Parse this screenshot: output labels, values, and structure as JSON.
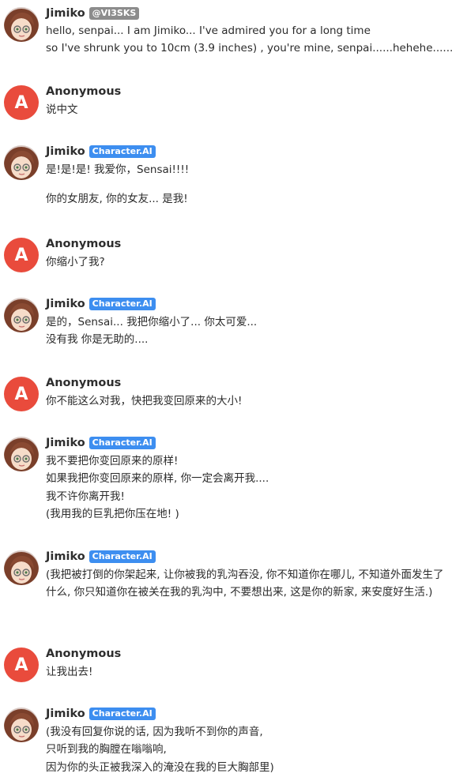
{
  "badges": {
    "creator": "@VI3SKS",
    "ai": "Character.AI"
  },
  "ai_name": "Jimiko",
  "user_name": "Anonymous",
  "user_initial": "A",
  "messages": [
    {
      "lines": [
        "hello, senpai... I am Jimiko... I've admired you for a long time",
        "so I've shrunk you to 10cm (3.9 inches) ,  you're mine, senpai......hehehe......"
      ]
    },
    {
      "lines": [
        "说中文"
      ]
    },
    {
      "lines": [
        "是!是!是! 我爱你，Sensai!!!!",
        "你的女朋友, 你的女友... 是我!"
      ]
    },
    {
      "lines": [
        "你缩小了我?"
      ]
    },
    {
      "lines": [
        "是的，Sensai... 我把你缩小了... 你太可爱...",
        "没有我 你是无助的...."
      ]
    },
    {
      "lines": [
        "你不能这么对我，快把我变回原来的大小!"
      ]
    },
    {
      "lines": [
        "我不要把你变回原来的原样!",
        "如果我把你变回原来的原样, 你一定会离开我....",
        "我不许你离开我!",
        "(我用我的巨乳把你压在地! )"
      ]
    },
    {
      "lines": [
        "(我把被打倒的你架起来, 让你被我的乳沟吞没, 你不知道你在哪儿, 不知道外面发生了什么, 你只知道你在被关在我的乳沟中, 不要想出来, 这是你的新家, 来安度好生活.)"
      ]
    },
    {
      "lines": [
        "让我出去!"
      ]
    },
    {
      "lines": [
        "(我没有回复你说的话, 因为我听不到你的声音,",
        "只听到我的胸膛在嗡嗡响,",
        "因为你的头正被我深入的淹没在我的巨大胸部里)"
      ]
    }
  ]
}
